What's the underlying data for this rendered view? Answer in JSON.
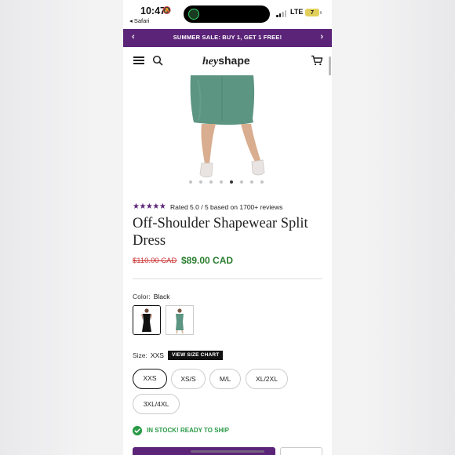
{
  "status_bar": {
    "time": "10:47",
    "back_app": "◂ Safari",
    "network": "LTE",
    "battery": "7"
  },
  "promo": {
    "text": "SUMMER SALE: BUY 1, GET 1 FREE!",
    "prev_icon": "chevron-left-icon",
    "next_icon": "chevron-right-icon",
    "background": "#5b2478"
  },
  "header": {
    "logo_part1": "hey",
    "logo_part2": "shape",
    "menu_icon": "hamburger-menu-icon",
    "search_icon": "search-icon",
    "cart_icon": "cart-icon"
  },
  "gallery": {
    "total_images": 8,
    "active_index": 4
  },
  "product": {
    "stars_glyphs": "★★★★★",
    "rating_text": "Rated 5.0 / 5 based on 1700+ reviews",
    "title": "Off-Shoulder Shapewear Split Dress",
    "price_original": "$110.00 CAD",
    "price_sale": "$89.00 CAD",
    "color_label": "Color:",
    "color_value": "Black",
    "colors": [
      "Black",
      "Sage Green"
    ],
    "selected_color_index": 0,
    "size_label": "Size:",
    "size_value": "XXS",
    "size_chart_label": "VIEW SIZE CHART",
    "sizes": [
      "XXS",
      "XS/S",
      "M/L",
      "XL/2XL",
      "3XL/4XL"
    ],
    "selected_size_index": 0,
    "stock_text": "IN STOCK! READY TO SHIP"
  },
  "colors": {
    "brand": "#5b2478",
    "sale_price": "#2a7d2e",
    "strike_price": "#cc3333",
    "in_stock": "#2a9a47",
    "dress_green": "#5c9582"
  }
}
